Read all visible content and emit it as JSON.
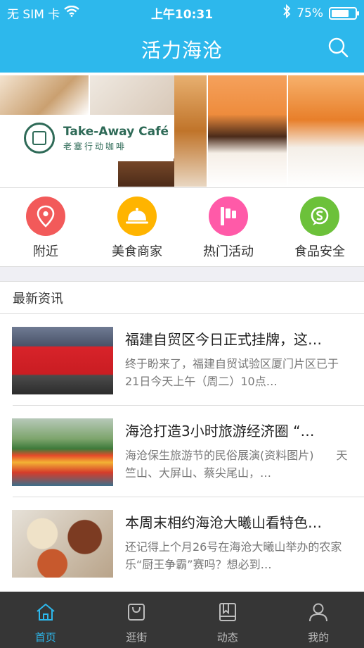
{
  "status_bar": {
    "carrier": "无 SIM 卡",
    "time": "上午10:31",
    "battery_text": "75%",
    "battery_level": 0.75
  },
  "nav": {
    "title": "活力海沧"
  },
  "banner": {
    "brand_en": "Take-Away Café",
    "brand_cn": "老塞行动咖啡"
  },
  "categories": [
    {
      "label": "附近",
      "icon": "location-pin-icon",
      "color": "#f25a5a"
    },
    {
      "label": "美食商家",
      "icon": "food-cloche-icon",
      "color": "#ffb400"
    },
    {
      "label": "热门活动",
      "icon": "flag-icon",
      "color": "#ff5aa8"
    },
    {
      "label": "食品安全",
      "icon": "safety-shield-icon",
      "color": "#6cc13a"
    }
  ],
  "news": {
    "section_title": "最新资讯",
    "items": [
      {
        "title": "福建自贸区今日正式挂牌，这…",
        "desc": "终于盼来了，福建自贸试验区厦门片区已于21日今天上午（周二）10点…"
      },
      {
        "title": "海沧打造3小时旅游经济圈 “…",
        "desc": "海沧保生旅游节的民俗展演(资料图片)　　天竺山、大屏山、蔡尖尾山，…"
      },
      {
        "title": "本周末相约海沧大曦山看特色…",
        "desc": "还记得上个月26号在海沧大曦山举办的农家乐“厨王争霸”赛吗？想必到…"
      }
    ]
  },
  "tabbar": {
    "active_color": "#2db8ec",
    "tabs": [
      {
        "label": "首页",
        "icon": "home-icon",
        "active": true
      },
      {
        "label": "逛街",
        "icon": "shopping-bag-icon",
        "active": false
      },
      {
        "label": "动态",
        "icon": "book-icon",
        "active": false
      },
      {
        "label": "我的",
        "icon": "user-icon",
        "active": false
      }
    ]
  }
}
